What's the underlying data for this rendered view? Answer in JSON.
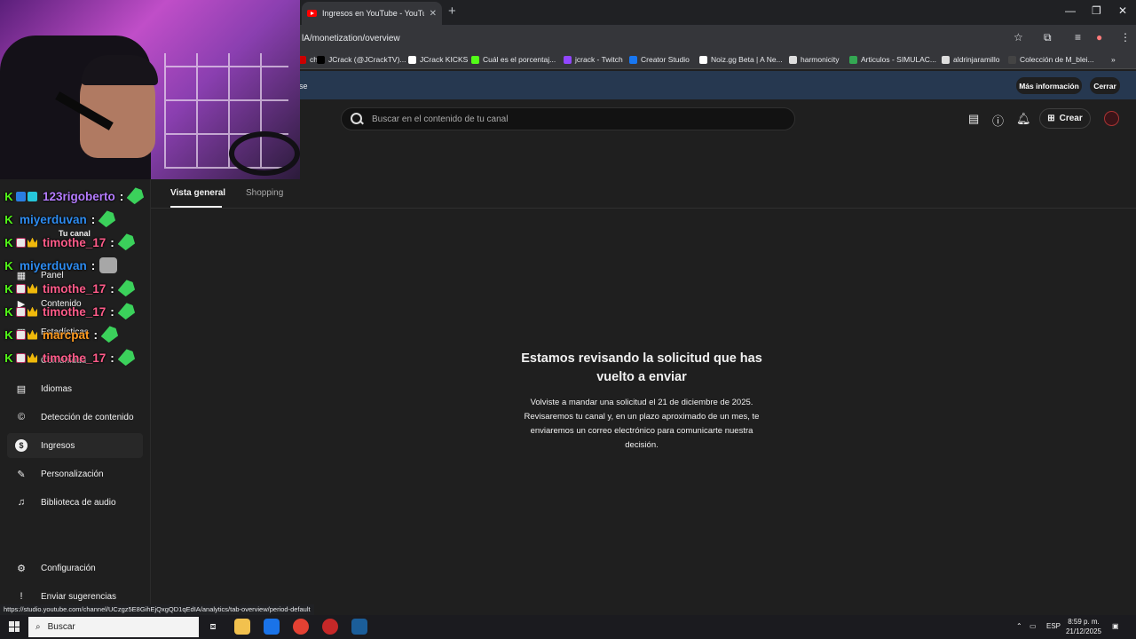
{
  "browser": {
    "tab_title": "Ingresos en YouTube - YouTube",
    "url": "lA/monetization/overview",
    "bookmarks": [
      {
        "label": "ch",
        "color": "#cc0000"
      },
      {
        "label": "JCrack (@JCrackTV)...",
        "color": "#000000"
      },
      {
        "label": "JCrack KICKS",
        "color": "#ffffff"
      },
      {
        "label": "Cuál es el porcentaj...",
        "color": "#53fc18"
      },
      {
        "label": "jcrack - Twitch",
        "color": "#9146ff"
      },
      {
        "label": "Creator Studio",
        "color": "#1877f2"
      },
      {
        "label": "Noiz.gg Beta | A Ne...",
        "color": "#ffffff"
      },
      {
        "label": "harmonicity",
        "color": "#dddddd"
      },
      {
        "label": "Articulos - SIMULAC...",
        "color": "#34a853"
      },
      {
        "label": "aldrinjaramillo",
        "color": "#dddddd"
      },
      {
        "label": "Colección de M_blei...",
        "color": "#444444"
      }
    ],
    "infobar_text": "se",
    "infobar_more": "Más información",
    "infobar_close": "Cerrar",
    "status_url": "https://studio.youtube.com/channel/UCzgz5E8GihEjQxgQD1qEdIA/analytics/tab-overview/period-default"
  },
  "studio": {
    "search_placeholder": "Buscar en el contenido de tu canal",
    "create_label": "Crear",
    "channel_label": "Tu canal",
    "nav": [
      {
        "label": "Panel",
        "icon": "dashboard-icon"
      },
      {
        "label": "Contenido",
        "icon": "content-icon"
      },
      {
        "label": "Estadísticas",
        "icon": "analytics-icon"
      },
      {
        "label": "Comunidad",
        "icon": "community-icon"
      },
      {
        "label": "Idiomas",
        "icon": "subtitles-icon"
      },
      {
        "label": "Detección de contenido",
        "icon": "copyright-icon"
      },
      {
        "label": "Ingresos",
        "icon": "dollar-icon"
      },
      {
        "label": "Personalización",
        "icon": "magic-wand-icon"
      },
      {
        "label": "Biblioteca de audio",
        "icon": "audio-library-icon"
      },
      {
        "label": "Configuración",
        "icon": "gear-icon"
      },
      {
        "label": "Enviar sugerencias",
        "icon": "feedback-icon"
      }
    ],
    "tabs": [
      "Vista general",
      "Shopping"
    ],
    "review_title": "Estamos revisando la solicitud que has vuelto a enviar",
    "review_body": "Volviste a mandar una solicitud el 21 de diciembre de 2025. Revisaremos tu canal y, en un plazo aproximado de un mes, te enviaremos un correo electrónico para comunicarte nuestra decisión."
  },
  "chat": [
    {
      "user": "123rigoberto",
      "color": "#b57cff"
    },
    {
      "user": "miyerduvan",
      "color": "#2e8cf0"
    },
    {
      "user": "timothe_17",
      "color": "#ff5c8a"
    },
    {
      "user": "miyerduvan",
      "color": "#2e8cf0"
    },
    {
      "user": "timothe_17",
      "color": "#ff5c8a"
    },
    {
      "user": "timothe_17",
      "color": "#ff5c8a"
    },
    {
      "user": "marcpat",
      "color": "#ff9a1f"
    },
    {
      "user": "timothe_17",
      "color": "#ff5c8a"
    }
  ],
  "taskbar": {
    "search_label": "Buscar",
    "lang": "ESP",
    "time": "8:59 p. m.",
    "date": "21/12/2025"
  }
}
